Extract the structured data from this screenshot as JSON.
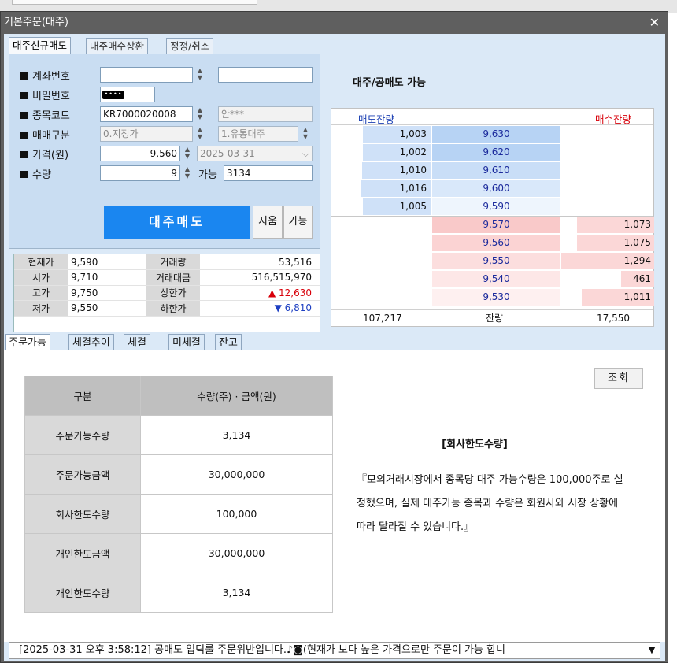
{
  "window": {
    "title": "기본주문(대주)"
  },
  "top_tabs": [
    "대주신규매도",
    "대주매수상환",
    "정정/취소"
  ],
  "form": {
    "account_label": "계좌번호",
    "password_label": "비밀번호",
    "password_mask": "••••",
    "code_label": "종목코드",
    "code_value": "KR7000020008",
    "name_value": "안***",
    "trade_type_label": "매매구분",
    "trade_type_value": "0.지정가",
    "loan_type_value": "1.유통대주",
    "price_label": "가격(원)",
    "price_value": "9,560",
    "date_value": "2025-03-31",
    "qty_label": "수량",
    "qty_value": "9",
    "avail_label": "가능",
    "avail_value": "3134",
    "sell_button": "대주매도",
    "clear_button": "지움",
    "avail_button": "가능"
  },
  "price_info": [
    [
      "현재가",
      "9,590",
      "거래량",
      "53,516"
    ],
    [
      "시가",
      "9,710",
      "거래대금",
      "516,515,970"
    ],
    [
      "고가",
      "9,750",
      "상한가",
      "12,630"
    ],
    [
      "저가",
      "9,550",
      "하한가",
      "6,810"
    ]
  ],
  "orderbook": {
    "title": "대주/공매도 가능",
    "ask_header": "매도잔량",
    "bid_header": "매수잔량",
    "asks": [
      {
        "qty": "1,003",
        "price": "9,630",
        "ratio": 0.93
      },
      {
        "qty": "1,002",
        "price": "9,620",
        "ratio": 0.93
      },
      {
        "qty": "1,010",
        "price": "9,610",
        "ratio": 0.94
      },
      {
        "qty": "1,016",
        "price": "9,600",
        "ratio": 0.95
      },
      {
        "qty": "1,005",
        "price": "9,590",
        "ratio": 0.93
      }
    ],
    "bids": [
      {
        "qty": "1,073",
        "price": "9,570",
        "ratio": 0.83
      },
      {
        "qty": "1,075",
        "price": "9,560",
        "ratio": 0.83
      },
      {
        "qty": "1,294",
        "price": "9,550",
        "ratio": 1.0
      },
      {
        "qty": "461",
        "price": "9,540",
        "ratio": 0.36
      },
      {
        "qty": "1,011",
        "price": "9,530",
        "ratio": 0.78
      }
    ],
    "total_ask": "107,217",
    "total_label": "잔량",
    "total_bid": "17,550"
  },
  "sub_tabs": [
    "주문가능",
    "체결추이",
    "체결",
    "미체결",
    "잔고"
  ],
  "availability": {
    "header_col1": "구분",
    "header_col2": "수량(주) · 금액(원)",
    "rows": [
      [
        "주문가능수량",
        "3,134"
      ],
      [
        "주문가능금액",
        "30,000,000"
      ],
      [
        "회사한도수량",
        "100,000"
      ],
      [
        "개인한도금액",
        "30,000,000"
      ],
      [
        "개인한도수량",
        "3,134"
      ]
    ]
  },
  "query_button": "조회",
  "notice": {
    "title": "[회사한도수량]",
    "body": "『모의거래시장에서 종목당 대주 가능수량은 100,000주로 설정했으며, 실제 대주가능 종목과 수량은 회원사와 시장 상황에 따라 달라질 수 있습니다.』"
  },
  "status_message": "[2025-03-31 오후 3:58:12] 공매도 업틱룰 주문위반입니다.♪◙(현재가 보다 높은 가격으로만 주문이 가능 합니",
  "colors": {
    "sell_button": "#1a86f0",
    "ask_bar": "#cfe1f8",
    "bid_bar": "#fbd7d7",
    "up": "#d8000a",
    "down": "#1d3fc2"
  }
}
